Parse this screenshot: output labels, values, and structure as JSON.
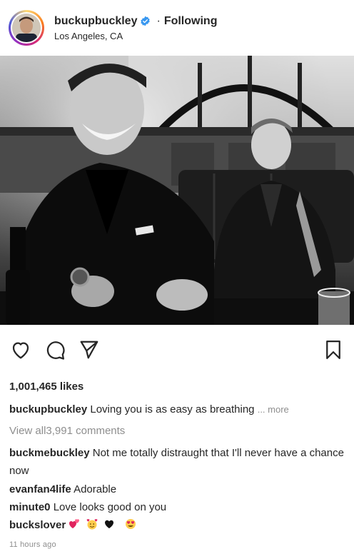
{
  "header": {
    "username": "buckupbuckley",
    "separator": "·",
    "follow_status": "Following",
    "location": "Los Angeles, CA"
  },
  "post": {
    "image_alt": "Black and white photo of two men in suits smiling in a bar booth",
    "likes": "1,001,465 likes",
    "caption_user": "buckupbuckley",
    "caption_text": "Loving you is as easy as breathing",
    "more_label": "... more",
    "view_all": "View all3,991 comments",
    "timestamp": "11 hours ago"
  },
  "comments": [
    {
      "user": "buckmebuckley",
      "text": "Not me totally distraught that I'll never have a chance now"
    },
    {
      "user": "evanfan4life",
      "text": "Adorable"
    },
    {
      "user": "minute0",
      "text": "Love looks good on you"
    },
    {
      "user": "buckslover",
      "text": ""
    }
  ],
  "icons": {
    "verified": "verified-badge-icon",
    "like": "heart-icon",
    "comment": "comment-bubble-icon",
    "share": "paper-plane-icon",
    "save": "bookmark-icon",
    "emojis": [
      "two-hearts",
      "smiling-face-with-hearts",
      "black-heart",
      "heart-eyes"
    ]
  },
  "colors": {
    "verified_blue": "#3897f0",
    "secondary_text": "#8e8e8e",
    "primary_text": "#262626"
  }
}
